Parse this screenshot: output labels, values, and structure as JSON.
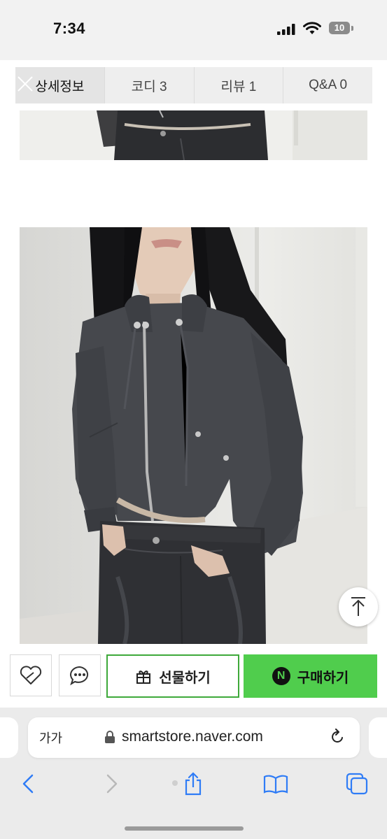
{
  "status_bar": {
    "time": "7:34",
    "battery": "10"
  },
  "tabs": [
    {
      "label": "상세정보"
    },
    {
      "label": "코디 3"
    },
    {
      "label": "리뷰 1"
    },
    {
      "label": "Q&A 0"
    }
  ],
  "actions": {
    "gift_label": "선물하기",
    "buy_label": "구매하기",
    "buy_badge": "N"
  },
  "browser": {
    "text_size_label": "가가",
    "url": "smartstore.naver.com"
  },
  "colors": {
    "accent_green": "#50cd4d",
    "gift_border": "#3ea93a",
    "ios_blue": "#2f7cf6"
  }
}
